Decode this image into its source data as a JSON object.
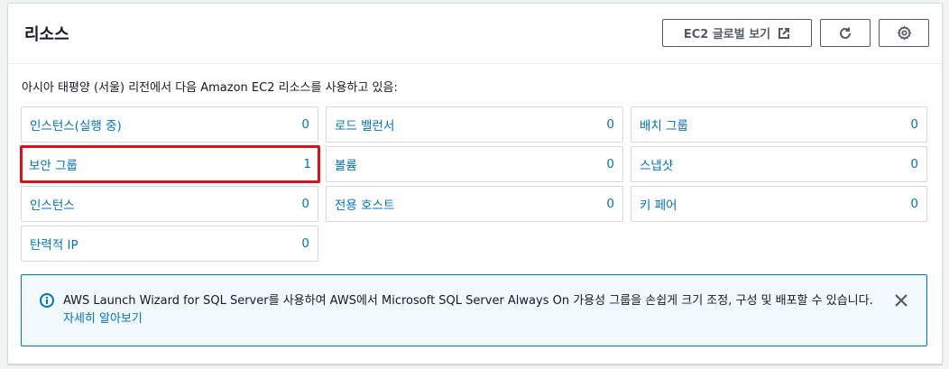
{
  "panel": {
    "title": "리소스",
    "global_view_button": "EC2 글로벌 보기",
    "intro_text": "아시아 태평양 (서울) 리전에서 다음 Amazon EC2 리소스를 사용하고 있음:"
  },
  "tiles": [
    {
      "label": "인스턴스(실행 중)",
      "count": "0"
    },
    {
      "label": "로드 밸런서",
      "count": "0"
    },
    {
      "label": "배치 그룹",
      "count": "0"
    },
    {
      "label": "보안 그룹",
      "count": "1"
    },
    {
      "label": "볼륨",
      "count": "0"
    },
    {
      "label": "스냅샷",
      "count": "0"
    },
    {
      "label": "인스턴스",
      "count": "0"
    },
    {
      "label": "전용 호스트",
      "count": "0"
    },
    {
      "label": "키 페어",
      "count": "0"
    },
    {
      "label": "탄력적 IP",
      "count": "0"
    }
  ],
  "alert": {
    "message": "AWS Launch Wizard for SQL Server를 사용하여 AWS에서 Microsoft SQL Server Always On 가용성 그룹을 손쉽게 크기 조정, 구성 및 배포할 수 있습니다.",
    "link": "자세히 알아보기"
  },
  "colors": {
    "link": "#0073bb",
    "highlight_border": "#e0101a",
    "alert_border": "#0073bb",
    "alert_bg": "#f1faff"
  },
  "icons": [
    "external-link-icon",
    "refresh-icon",
    "settings-icon",
    "info-icon",
    "close-icon"
  ]
}
